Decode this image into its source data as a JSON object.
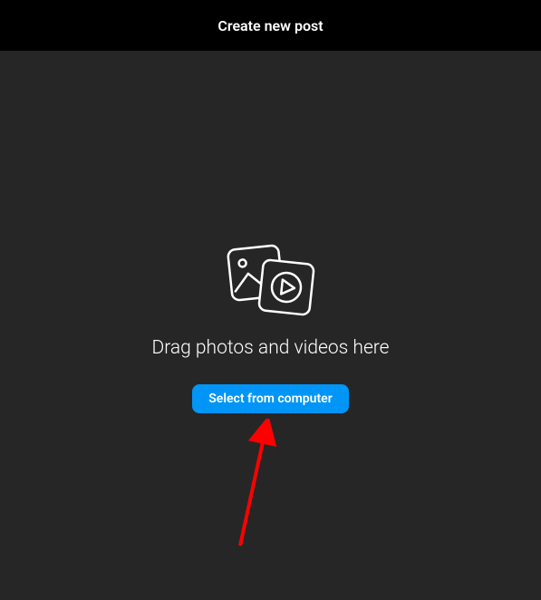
{
  "header": {
    "title": "Create new post"
  },
  "upload": {
    "prompt": "Drag photos and videos here",
    "button_label": "Select from computer",
    "icon_name": "media-upload-icon"
  },
  "annotation": {
    "type": "arrow",
    "color": "#ff0000",
    "points_to": "select-from-computer-button"
  }
}
